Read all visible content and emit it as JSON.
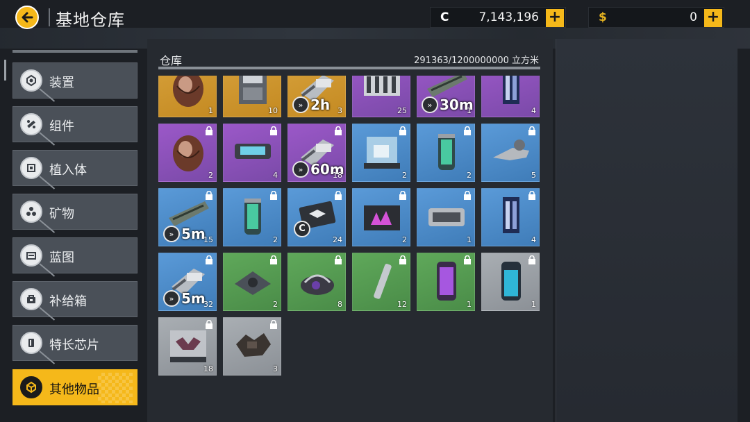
{
  "header": {
    "title": "基地仓库",
    "currencies": [
      {
        "symbol": "C",
        "value": "7,143,196",
        "plus": "+"
      },
      {
        "symbol": "$",
        "value": "0",
        "plus": "+"
      }
    ]
  },
  "sidebar": {
    "items": [
      {
        "label": "装置",
        "icon": "device-icon"
      },
      {
        "label": "组件",
        "icon": "component-icon"
      },
      {
        "label": "植入体",
        "icon": "implant-icon"
      },
      {
        "label": "矿物",
        "icon": "mineral-icon"
      },
      {
        "label": "蓝图",
        "icon": "blueprint-icon"
      },
      {
        "label": "补给箱",
        "icon": "supply-box-icon"
      },
      {
        "label": "特长芯片",
        "icon": "chip-icon"
      },
      {
        "label": "其他物品",
        "icon": "other-items-icon",
        "active": true
      }
    ]
  },
  "warehouse": {
    "title": "仓库",
    "capacity": "291363/1200000000 立方米",
    "items": [
      {
        "rarity": "orange",
        "count": "1",
        "object": "seed-pod"
      },
      {
        "rarity": "orange",
        "count": "10",
        "object": "machine-part"
      },
      {
        "rarity": "orange",
        "count": "3",
        "timer": "2h",
        "object": "engine-part"
      },
      {
        "rarity": "purple",
        "count": "25",
        "object": "ship-module"
      },
      {
        "rarity": "purple",
        "count": "1",
        "timer": "30m",
        "object": "hull-part"
      },
      {
        "rarity": "purple",
        "count": "4",
        "object": "tower-module"
      },
      {
        "rarity": "purple",
        "count": "2",
        "locked": true,
        "object": "seed-pod"
      },
      {
        "rarity": "purple",
        "count": "4",
        "locked": true,
        "object": "device-case"
      },
      {
        "rarity": "purple",
        "count": "18",
        "locked": true,
        "timer": "60m",
        "object": "engine-part"
      },
      {
        "rarity": "blue",
        "count": "2",
        "locked": true,
        "object": "glass-tank"
      },
      {
        "rarity": "blue",
        "count": "2",
        "locked": true,
        "object": "canister"
      },
      {
        "rarity": "blue",
        "count": "5",
        "locked": true,
        "object": "tool-part"
      },
      {
        "rarity": "blue",
        "count": "15",
        "locked": true,
        "timer": "5m",
        "object": "hull-part"
      },
      {
        "rarity": "blue",
        "count": "2",
        "locked": true,
        "object": "canister"
      },
      {
        "rarity": "blue",
        "count": "24",
        "locked": true,
        "badge": "C",
        "object": "card"
      },
      {
        "rarity": "blue",
        "count": "2",
        "locked": true,
        "object": "crystal-case"
      },
      {
        "rarity": "blue",
        "count": "1",
        "locked": true,
        "object": "metal-case"
      },
      {
        "rarity": "blue",
        "count": "4",
        "locked": true,
        "object": "tower-module"
      },
      {
        "rarity": "blue",
        "count": "32",
        "locked": true,
        "timer": "5m",
        "object": "engine-part"
      },
      {
        "rarity": "green",
        "count": "2",
        "locked": true,
        "object": "plate"
      },
      {
        "rarity": "green",
        "count": "8",
        "locked": true,
        "object": "relic"
      },
      {
        "rarity": "green",
        "count": "12",
        "locked": true,
        "object": "rod"
      },
      {
        "rarity": "green",
        "count": "1",
        "locked": true,
        "object": "purple-canister"
      },
      {
        "rarity": "gray",
        "count": "1",
        "locked": true,
        "object": "blue-canister"
      },
      {
        "rarity": "gray",
        "count": "18",
        "locked": true,
        "object": "creature-case"
      },
      {
        "rarity": "gray",
        "count": "3",
        "locked": true,
        "object": "debris"
      }
    ]
  },
  "colors": {
    "accent": "#f5b81a",
    "orange": "#d6a03a",
    "purple": "#9b58c8",
    "blue": "#5a9ad8",
    "green": "#5fa85a",
    "gray": "#a9aeb3"
  }
}
